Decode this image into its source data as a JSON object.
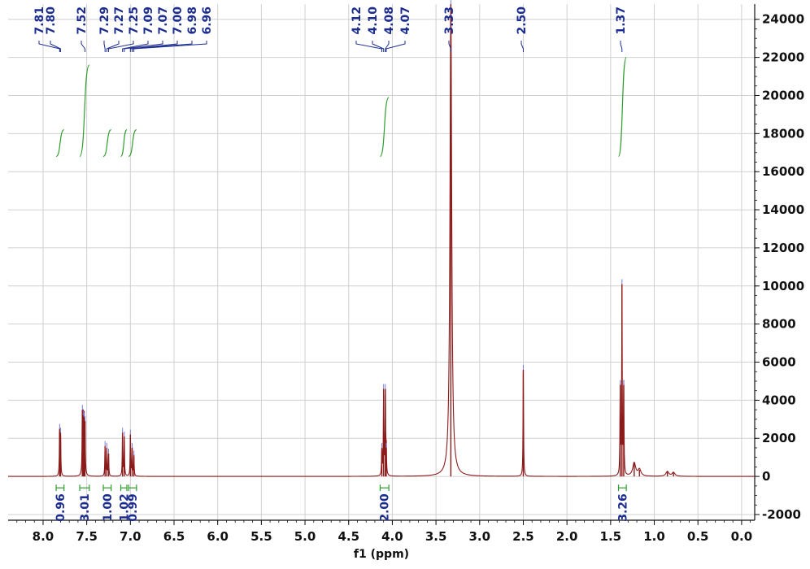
{
  "chart_data": {
    "type": "line",
    "title": "",
    "xlabel": "f1 (ppm)",
    "ylabel": "",
    "xlim": [
      8.4,
      -0.15
    ],
    "ylim": [
      -2300,
      24800
    ],
    "x_reversed": true,
    "grid": true,
    "x_ticks": [
      8.0,
      7.5,
      7.0,
      6.5,
      6.0,
      5.5,
      5.0,
      4.5,
      4.0,
      3.5,
      3.0,
      2.5,
      2.0,
      1.5,
      1.0,
      0.5,
      0.0
    ],
    "x_tick_labels": [
      "8.0",
      "7.5",
      "7.0",
      "6.5",
      "6.0",
      "5.5",
      "5.0",
      "4.5",
      "4.0",
      "3.5",
      "3.0",
      "2.5",
      "2.0",
      "1.5",
      "1.0",
      "0.5",
      "0.0"
    ],
    "y_ticks": [
      -2000,
      0,
      2000,
      4000,
      6000,
      8000,
      10000,
      12000,
      14000,
      16000,
      18000,
      20000,
      22000,
      24000
    ],
    "y_tick_labels": [
      "-2000",
      "0",
      "2000",
      "4000",
      "6000",
      "8000",
      "10000",
      "12000",
      "14000",
      "16000",
      "18000",
      "20000",
      "22000",
      "24000"
    ],
    "peaks": [
      {
        "x": 7.81,
        "y": 2500
      },
      {
        "x": 7.8,
        "y": 2300
      },
      {
        "x": 7.55,
        "y": 3500
      },
      {
        "x": 7.54,
        "y": 3200
      },
      {
        "x": 7.53,
        "y": 3100
      },
      {
        "x": 7.52,
        "y": 2900
      },
      {
        "x": 7.29,
        "y": 1600
      },
      {
        "x": 7.27,
        "y": 1500
      },
      {
        "x": 7.25,
        "y": 1200
      },
      {
        "x": 7.09,
        "y": 2300
      },
      {
        "x": 7.07,
        "y": 2100
      },
      {
        "x": 7.0,
        "y": 2200
      },
      {
        "x": 6.98,
        "y": 1500
      },
      {
        "x": 6.96,
        "y": 1100
      },
      {
        "x": 4.12,
        "y": 1500
      },
      {
        "x": 4.1,
        "y": 4600
      },
      {
        "x": 4.08,
        "y": 4600
      },
      {
        "x": 4.07,
        "y": 1500
      },
      {
        "x": 3.33,
        "y": 24800
      },
      {
        "x": 2.5,
        "y": 5600
      },
      {
        "x": 1.39,
        "y": 4800
      },
      {
        "x": 1.37,
        "y": 10100
      },
      {
        "x": 1.35,
        "y": 4800
      },
      {
        "x": 1.23,
        "y": 700
      },
      {
        "x": 1.17,
        "y": 350
      },
      {
        "x": 0.85,
        "y": 250
      },
      {
        "x": 0.78,
        "y": 200
      }
    ],
    "peak_labels": [
      "7.81",
      "7.80",
      "7.52",
      "7.29",
      "7.27",
      "7.25",
      "7.09",
      "7.07",
      "7.00",
      "6.98",
      "6.96",
      "4.12",
      "4.10",
      "4.08",
      "4.07",
      "3.33",
      "2.50",
      "1.37"
    ],
    "integrals": [
      {
        "from": 7.85,
        "to": 7.76,
        "value": "0.96"
      },
      {
        "from": 7.58,
        "to": 7.47,
        "value": "3.01"
      },
      {
        "from": 7.31,
        "to": 7.22,
        "value": "1.00"
      },
      {
        "from": 7.11,
        "to": 7.04,
        "value": "1.02"
      },
      {
        "from": 7.02,
        "to": 6.93,
        "value": "0.99"
      },
      {
        "from": 4.14,
        "to": 4.04,
        "value": "2.00"
      },
      {
        "from": 1.41,
        "to": 1.32,
        "value": "3.26"
      }
    ],
    "colors": {
      "spectrum": "#8b1a1a",
      "integral": "#2e9c2e",
      "label": "#1c2d8f",
      "grid": "#d0d0d0"
    }
  }
}
